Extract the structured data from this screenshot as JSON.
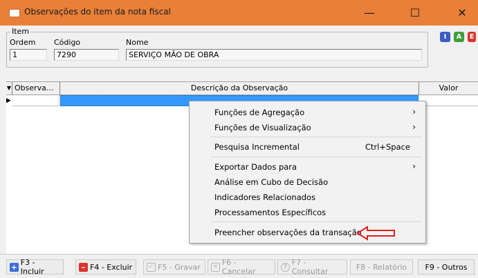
{
  "window": {
    "title": "Observações do item da nota fiscal",
    "min_glyph": "—",
    "max_glyph": "☐",
    "close_glyph": "✕"
  },
  "item_group": {
    "legend": "Item",
    "ordem_label": "Ordem",
    "ordem_value": "1",
    "codigo_label": "Código",
    "codigo_value": "7290",
    "nome_label": "Nome",
    "nome_value": "SERVIÇO MÃO DE OBRA"
  },
  "ia_buttons": {
    "i": "I",
    "a": "A",
    "e": "E"
  },
  "grid": {
    "columns": [
      "Observa...",
      "Descrição da Observação",
      "Valor"
    ],
    "row_indicator": "▶"
  },
  "context_menu": {
    "items": [
      {
        "label": "Funções de Agregação",
        "arrow": "›"
      },
      {
        "label": "Funções de Visualização",
        "arrow": "›"
      },
      {
        "label": "Pesquisa Incremental",
        "shortcut": "Ctrl+Space"
      },
      {
        "label": "Exportar Dados para",
        "arrow": "›"
      },
      {
        "label": "Análise em Cubo de Decisão"
      },
      {
        "label": "Indicadores Relacionados"
      },
      {
        "label": "Processamentos Específicos"
      },
      {
        "label": "Preencher observações da transação"
      }
    ],
    "arrow_color": "#e02020"
  },
  "toolbar": {
    "incluir": "F3 - Incluir",
    "excluir": "F4 - Excluir",
    "gravar": "F5 - Gravar",
    "cancelar": "F6 - Cancelar",
    "consultar": "F7 - Consultar",
    "relatorio": "F8 - Relatório",
    "outros": "F9 - Outros"
  },
  "colors": {
    "titlebar": "#e8803a",
    "selection": "#3399ff"
  }
}
